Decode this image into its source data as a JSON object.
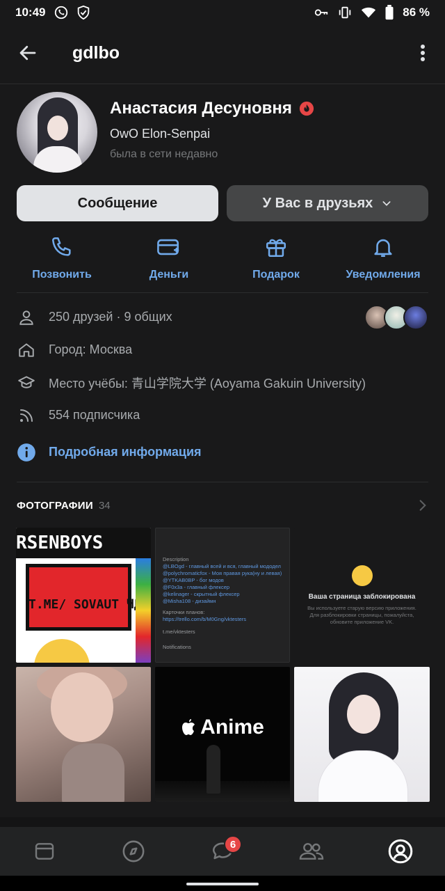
{
  "status_bar": {
    "time": "10:49",
    "battery": "86 %"
  },
  "header": {
    "title": "gdlbo"
  },
  "profile": {
    "name": "Анастасия Десуновня",
    "status": "OwO Elon-Senpai",
    "last_seen": "была в сети недавно"
  },
  "actions": {
    "message": "Сообщение",
    "friends": "У Вас в друзьях"
  },
  "quick_actions": [
    {
      "label": "Позвонить",
      "icon": "phone-icon"
    },
    {
      "label": "Деньги",
      "icon": "money-icon"
    },
    {
      "label": "Подарок",
      "icon": "gift-icon"
    },
    {
      "label": "Уведомления",
      "icon": "bell-icon"
    }
  ],
  "details": {
    "friends": "250 друзей · 9 общих",
    "city": "Город: Москва",
    "education": "Место учёбы: 青山学院大学 (Aoyama Gakuin University)",
    "followers": "554 подписчика",
    "more_info": "Подробная информация"
  },
  "photos": {
    "label": "ФОТОГРАФИИ",
    "count": "34",
    "p1_band": "RSENBOYS",
    "p1_text": "T.ME/ SOVAUT ЧДК",
    "p2_lines": [
      "Description",
      "@LBOgd - главный всей и вся, главный мододел",
      "@polychromaticfox - Моя правая рука(ну и левая)",
      "@YTKAB0BP - бог модов",
      "@F0x3a - главный флексер",
      "@kelinager - скрытный флексер",
      "@Misha108 - дизаймн",
      "Карточки планов:",
      "https://trello.com/b/M0Gng/vktesters",
      "t.me/vktesters",
      "Notifications"
    ],
    "p3_title": "Ваша страница заблокирована",
    "p3_text": "Вы используете старую версию приложения. Для разблокировки страницы, пожалуйста, обновите приложение VK.",
    "p5_text": "Anime"
  },
  "nav": {
    "badge": "6"
  },
  "colors": {
    "accent": "#71aaeb",
    "background": "#19191a",
    "badge": "#e64646",
    "verified": "#e64646"
  }
}
